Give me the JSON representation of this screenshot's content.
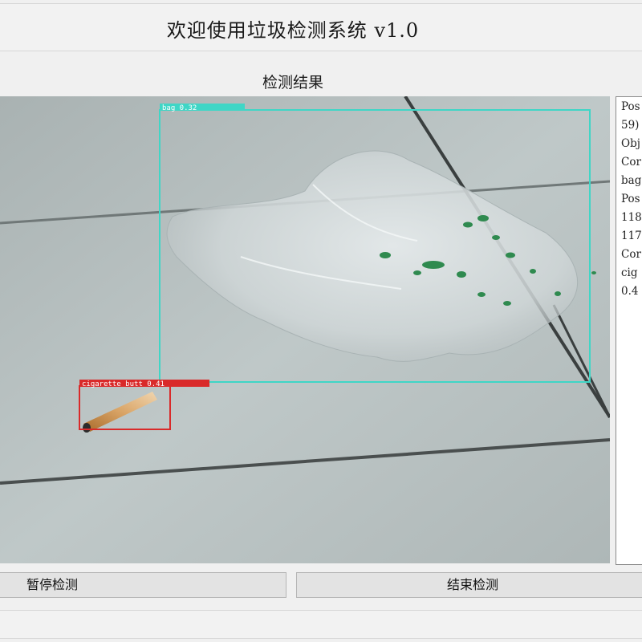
{
  "window": {
    "title": "欢迎使用垃圾检测系统 v1.0"
  },
  "results": {
    "heading": "检测结果"
  },
  "detections": [
    {
      "label": "bag 0.32",
      "class": "bag",
      "confidence": 0.32,
      "color": "#3fd6c6"
    },
    {
      "label": "cigarette butt 0.41",
      "class": "cigarette butt",
      "confidence": 0.41,
      "color": "#d92a2a"
    }
  ],
  "log": {
    "lines": [
      "Pos",
      "59)",
      "Obj",
      "Cor",
      "bag",
      "Pos",
      "118",
      "117",
      "Cor",
      "cig",
      "0.4"
    ]
  },
  "buttons": {
    "pause_label": "暂停检测",
    "stop_label": "结束检测"
  }
}
